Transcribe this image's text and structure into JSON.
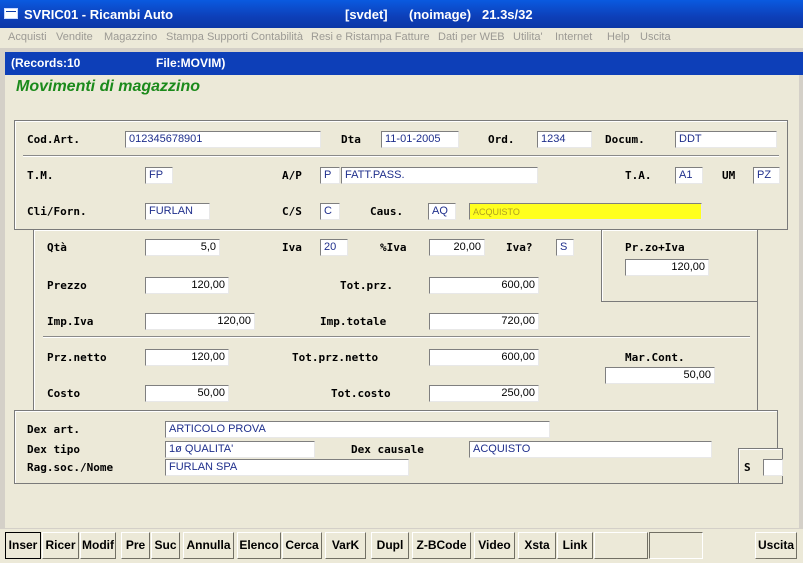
{
  "window": {
    "title": "SVRIC01 - Ricambi Auto",
    "mode": "[svdet]",
    "image": "(noimage)",
    "version": "21.3s/32"
  },
  "menu": [
    "Acquisti",
    "Vendite",
    "Magazzino",
    "Stampa Supporti Contabilità",
    "Resi e Ristampa Fatture",
    "Dati per WEB",
    "Utilita'",
    "Internet",
    "Help",
    "Uscita"
  ],
  "header": {
    "records": "(Records:10",
    "file": "File:MOVIM)"
  },
  "form_title": "Movimenti di magazzino",
  "labels": {
    "codart": "Cod.Art.",
    "dta": "Dta",
    "ord": "Ord.",
    "docum": "Docum.",
    "tm": "T.M.",
    "ap": "A/P",
    "ta": "T.A.",
    "um": "UM",
    "cliforn": "Cli/Forn.",
    "cs": "C/S",
    "caus": "Caus.",
    "qta": "Qtà",
    "iva": "Iva",
    "piva": "%Iva",
    "ivaq": "Iva?",
    "przziva": "Pr.zo+Iva",
    "prezzo": "Prezzo",
    "totprz": "Tot.prz.",
    "impiva": "Imp.Iva",
    "imptotale": "Imp.totale",
    "prznetto": "Prz.netto",
    "totprznetto": "Tot.prz.netto",
    "marcont": "Mar.Cont.",
    "costo": "Costo",
    "totcosto": "Tot.costo",
    "dexart": "Dex art.",
    "dextipo": "Dex tipo",
    "dexcausale": "Dex causale",
    "ragsoc": "Rag.soc./Nome",
    "s": "S"
  },
  "fields": {
    "codart": "012345678901",
    "dta": "11-01-2005",
    "ord": "1234",
    "docum": "DDT",
    "tm": "FP",
    "ap": "P",
    "ap_desc": "FATT.PASS.",
    "ta": "A1",
    "um": "PZ",
    "cliforn": "FURLAN",
    "cs": "C",
    "caus": "AQ",
    "caus_desc": "ACQUISTO",
    "qta": "5,0",
    "iva": "20",
    "piva": "20,00",
    "ivaq": "S",
    "przziva": "120,00",
    "prezzo": "120,00",
    "totprz": "600,00",
    "impiva": "120,00",
    "imptotale": "720,00",
    "prznetto": "120,00",
    "totprznetto": "600,00",
    "marcont": "50,00",
    "costo": "50,00",
    "totcosto": "250,00",
    "dexart": "ARTICOLO PROVA",
    "dextipo": "1ø QUALITA'",
    "dexcausale": "ACQUISTO",
    "ragsoc": "FURLAN SPA",
    "s": ""
  },
  "buttons": [
    "Inser",
    "Ricer",
    "Modif",
    "Pre",
    "Suc",
    "Annulla",
    "Elenco",
    "Cerca",
    "VarK",
    "Dupl",
    "Z-BCode",
    "Video",
    "Xsta",
    "Link",
    "",
    "",
    "Uscita"
  ]
}
